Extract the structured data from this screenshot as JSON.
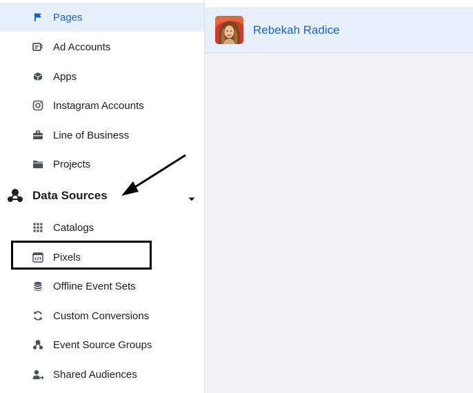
{
  "sidebar": {
    "items": [
      {
        "label": "Pages",
        "icon": "flag-icon",
        "selected": true
      },
      {
        "label": "Ad Accounts",
        "icon": "ad-account-icon"
      },
      {
        "label": "Apps",
        "icon": "cube-icon"
      },
      {
        "label": "Instagram Accounts",
        "icon": "instagram-icon"
      },
      {
        "label": "Line of Business",
        "icon": "briefcase-icon"
      },
      {
        "label": "Projects",
        "icon": "folder-icon"
      }
    ],
    "section": {
      "label": "Data Sources",
      "icon": "data-sources-icon",
      "expanded": true
    },
    "sub_items": [
      {
        "label": "Catalogs",
        "icon": "grid-icon"
      },
      {
        "label": "Pixels",
        "icon": "code-window-icon",
        "highlighted": true
      },
      {
        "label": "Offline Event Sets",
        "icon": "database-icon"
      },
      {
        "label": "Custom Conversions",
        "icon": "refresh-icon"
      },
      {
        "label": "Event Source Groups",
        "icon": "network-icon"
      },
      {
        "label": "Shared Audiences",
        "icon": "user-share-icon"
      }
    ]
  },
  "main": {
    "account": {
      "name": "Rebekah Radice",
      "avatar": "profile-photo"
    }
  },
  "colors": {
    "accent": "#1d63c7",
    "selected_bg": "#e7f0fb",
    "text": "#1c1e21",
    "icon": "#4b4f56",
    "panel_bg": "#f0f2f5"
  }
}
